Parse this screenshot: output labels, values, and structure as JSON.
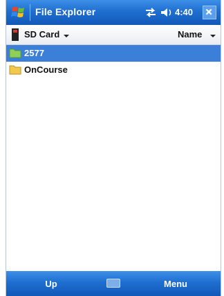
{
  "titlebar": {
    "title": "File Explorer",
    "time": "4:40",
    "start_icon": "windows-flag-icon",
    "connectivity_icon": "connectivity-icon",
    "volume_icon": "volume-icon",
    "close_icon": "close-icon"
  },
  "header": {
    "location": "SD Card",
    "sort": "Name"
  },
  "files": [
    {
      "name": "2577",
      "selected": true
    },
    {
      "name": "OnCourse",
      "selected": false
    }
  ],
  "softkeys": {
    "left": "Up",
    "right": "Menu",
    "keyboard_icon": "keyboard-icon"
  },
  "colors": {
    "titlebar": "#1f6fd0",
    "selection": "#3b7fd9",
    "folder": "#f2c94c"
  }
}
